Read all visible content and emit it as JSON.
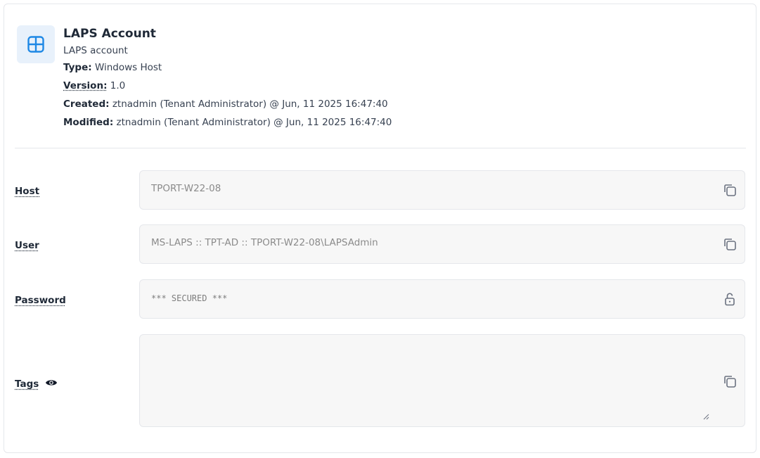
{
  "account": {
    "title": "LAPS Account",
    "subtitle": "LAPS account",
    "type_label": "Type:",
    "type_value": "Windows Host",
    "version_label": "Version:",
    "version_value": "1.0",
    "created_label": "Created:",
    "created_value": "ztnadmin (Tenant Administrator) @ Jun, 11 2025 16:47:40",
    "modified_label": "Modified:",
    "modified_value": "ztnadmin (Tenant Administrator) @ Jun, 11 2025 16:47:40",
    "icon": "windows-icon"
  },
  "fields": {
    "host": {
      "label": "Host",
      "value": "TPORT-W22-08",
      "icon": "copy-icon"
    },
    "user": {
      "label": "User",
      "value": "MS-LAPS :: TPT-AD :: TPORT-W22-08\\LAPSAdmin",
      "icon": "copy-icon"
    },
    "password": {
      "label": "Password",
      "value": "*** SECURED ***",
      "icon": "unlock-icon"
    },
    "tags": {
      "label": "Tags",
      "value": "",
      "icon": "copy-icon",
      "visibility_icon": "eye-icon"
    }
  },
  "colors": {
    "accent": "#1e88e5",
    "icon_bg": "#e8f1fb",
    "field_bg": "#f7f7f7",
    "field_text": "#8b8b8b"
  }
}
